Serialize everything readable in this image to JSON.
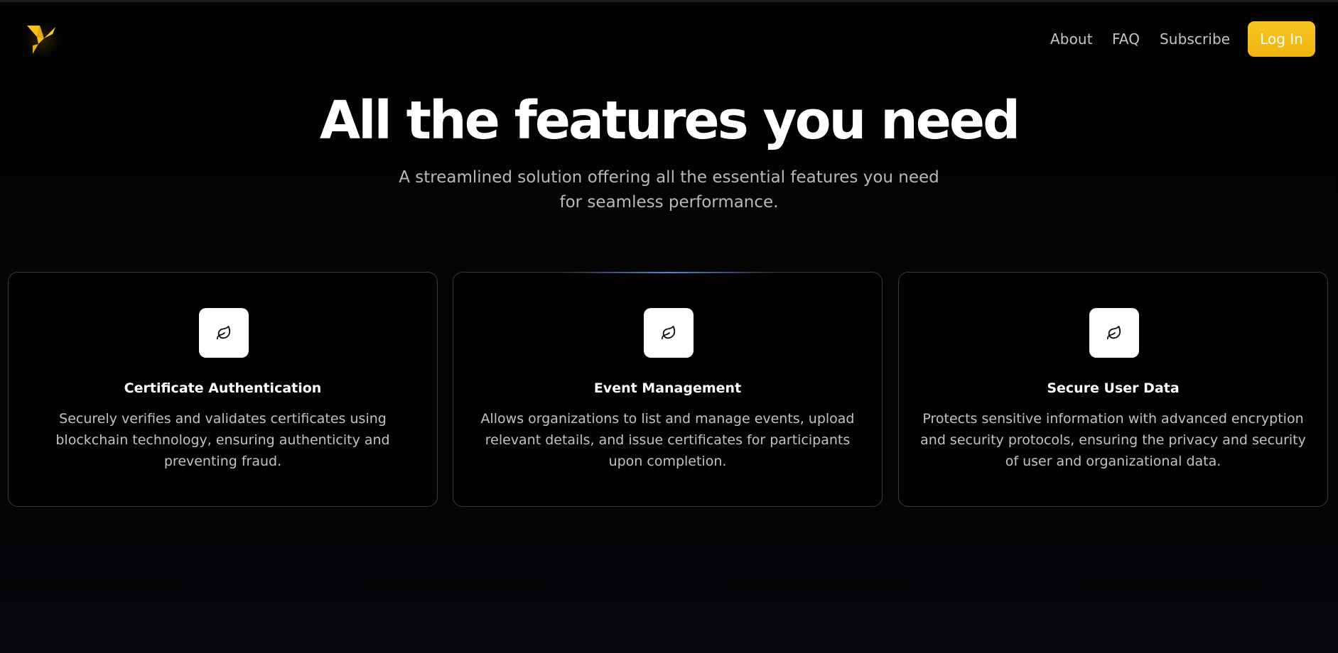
{
  "header": {
    "logo_icon": "bird-logo-icon",
    "brand_color": "#f5c21b",
    "nav": [
      {
        "label": "About"
      },
      {
        "label": "FAQ"
      },
      {
        "label": "Subscribe"
      }
    ],
    "login_label": "Log In"
  },
  "hero": {
    "title": "All the features you need",
    "subtitle": "A streamlined solution offering all the essential features you need for seamless performance."
  },
  "features": [
    {
      "icon": "leaf-icon",
      "title": "Certificate Authentication",
      "description": "Securely verifies and validates certificates using blockchain technology, ensuring authenticity and preventing fraud."
    },
    {
      "icon": "leaf-icon",
      "title": "Event Management",
      "description": "Allows organizations to list and manage events, upload relevant details, and issue certificates for participants upon completion."
    },
    {
      "icon": "leaf-icon",
      "title": "Secure User Data",
      "description": "Protects sensitive information with advanced encryption and security protocols, ensuring the privacy and security of user and organizational data."
    }
  ],
  "colors": {
    "background": "#040407",
    "accent": "#f5c21b",
    "card_border": "#3a3a3e",
    "highlight": "#5a8cf0"
  }
}
